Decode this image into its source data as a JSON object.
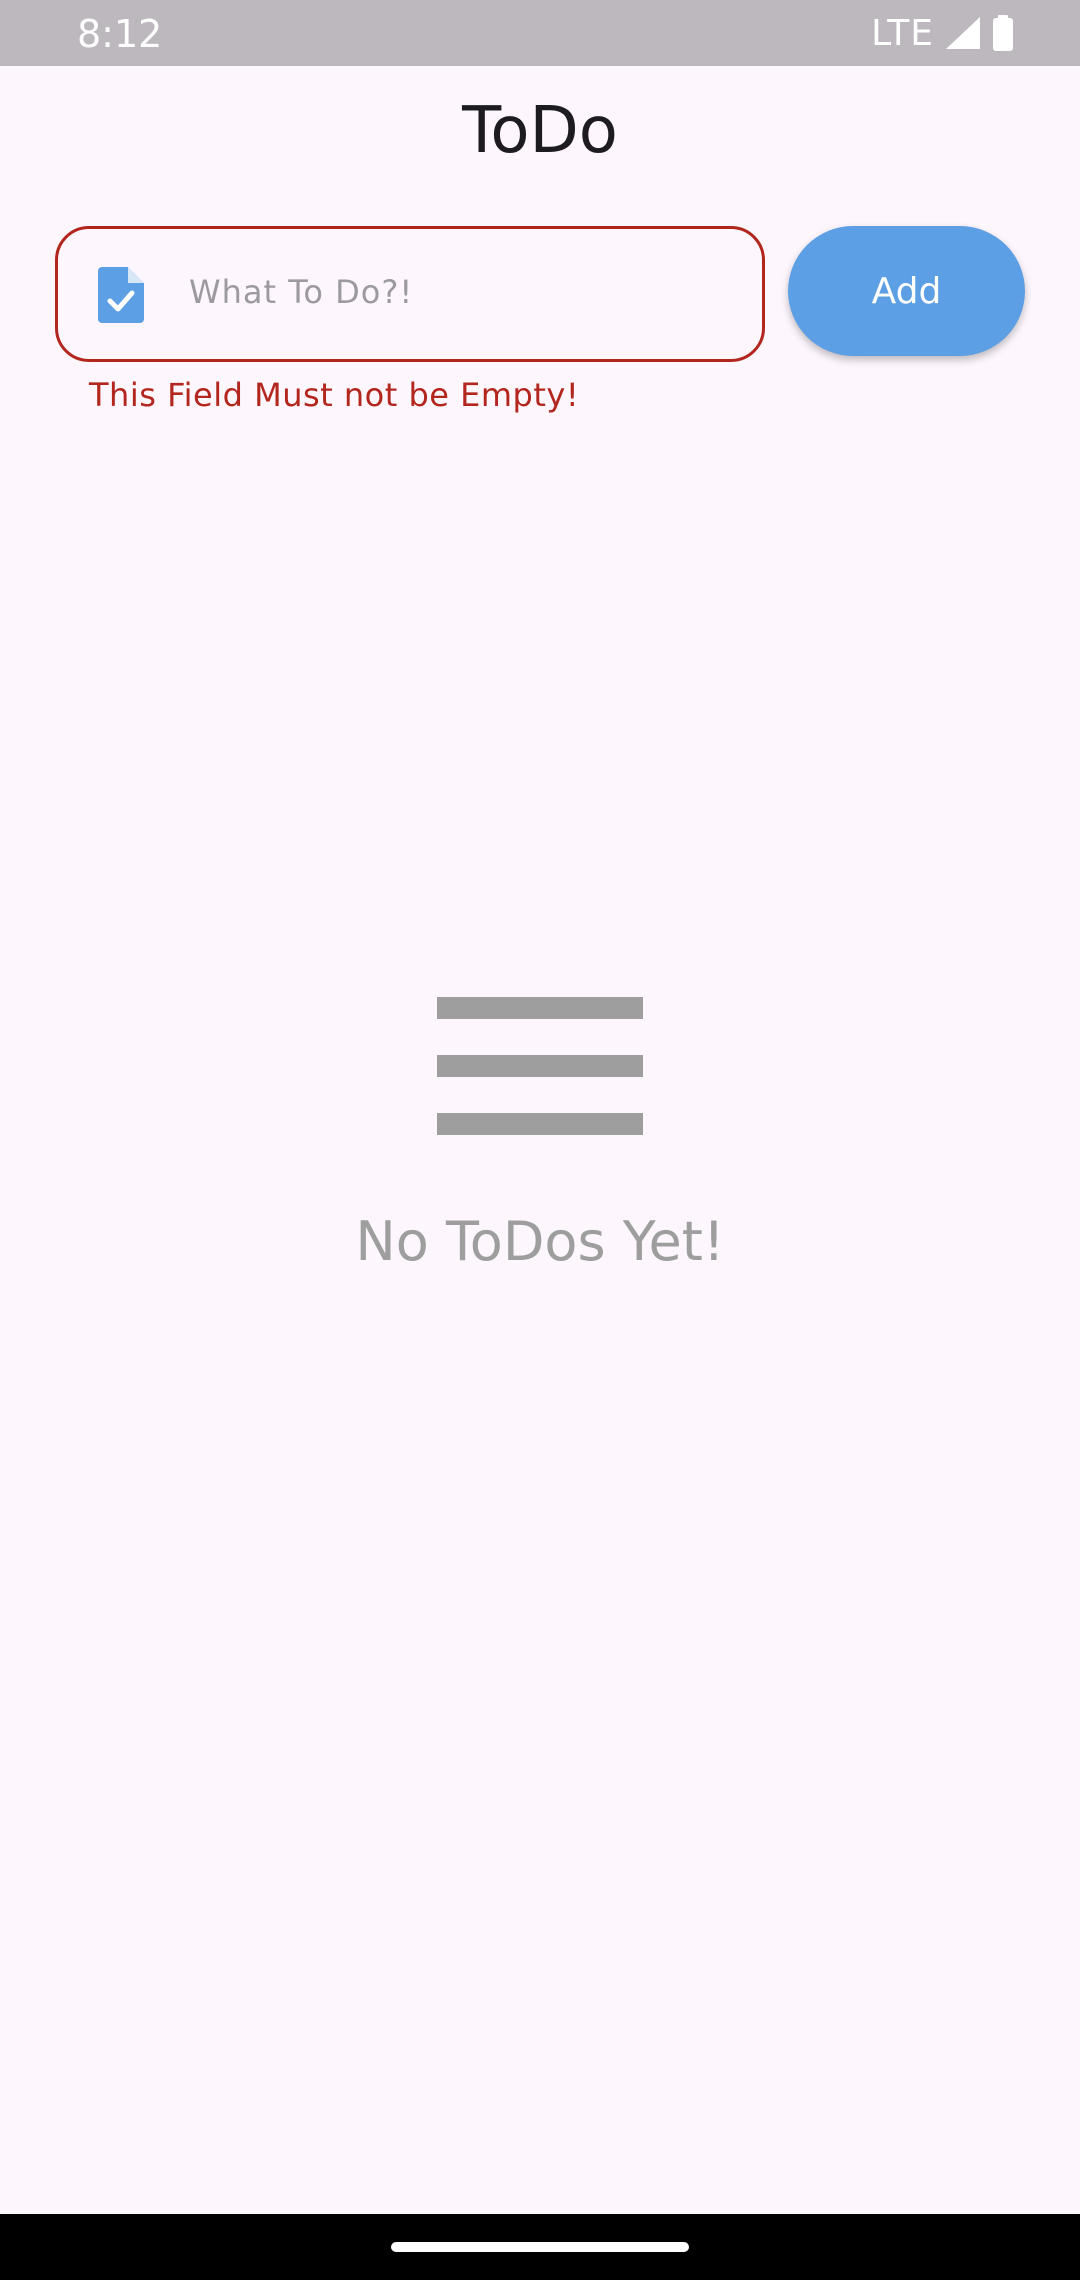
{
  "status_bar": {
    "time": "8:12",
    "network": "LTE",
    "icons": [
      "signal-icon",
      "battery-icon"
    ]
  },
  "app_bar": {
    "title": "ToDo"
  },
  "input": {
    "placeholder": "What To Do?!",
    "value": "",
    "icon": "task-document-icon",
    "error": "This Field Must not be Empty!"
  },
  "add_button": {
    "label": "Add"
  },
  "empty_state": {
    "icon": "list-icon",
    "message": "No ToDos Yet!"
  },
  "colors": {
    "accent": "#5d9fe4",
    "error": "#b3261e",
    "background": "#fdf7fd",
    "muted": "#9e9e9e"
  }
}
